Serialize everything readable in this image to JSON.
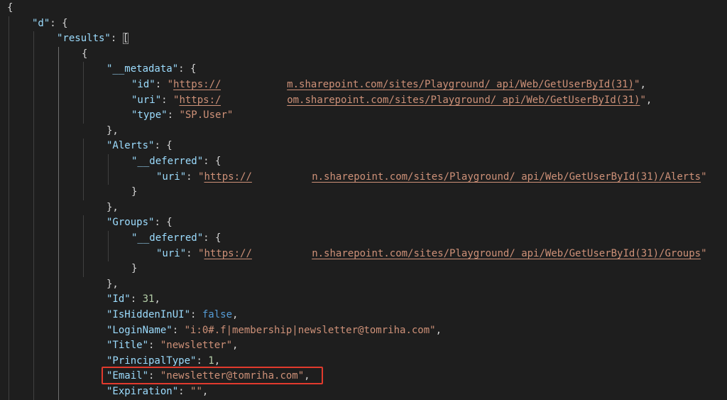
{
  "lines": [
    [
      {
        "t": "{",
        "c": "punc"
      }
    ],
    [
      {
        "t": "\"d\"",
        "c": "key"
      },
      {
        "t": ": {",
        "c": "punc"
      }
    ],
    [
      {
        "t": "\"results\"",
        "c": "key"
      },
      {
        "t": ": ",
        "c": "punc"
      },
      {
        "t": "[",
        "c": "punc bracket-match"
      }
    ],
    [
      {
        "t": "{",
        "c": "punc"
      }
    ],
    [
      {
        "t": "\"__metadata\"",
        "c": "key"
      },
      {
        "t": ": {",
        "c": "punc"
      }
    ],
    [
      {
        "t": "\"id\"",
        "c": "key"
      },
      {
        "t": ": ",
        "c": "punc"
      },
      {
        "t": "\"",
        "c": "str"
      },
      {
        "t": "https://",
        "c": "link"
      },
      {
        "t": "           ",
        "c": "redact"
      },
      {
        "t": "m.sharepoint.com/sites/Playground/_api/Web/GetUserById(31)",
        "c": "link"
      },
      {
        "t": "\"",
        "c": "str"
      },
      {
        "t": ",",
        "c": "punc"
      }
    ],
    [
      {
        "t": "\"uri\"",
        "c": "key"
      },
      {
        "t": ": ",
        "c": "punc"
      },
      {
        "t": "\"",
        "c": "str"
      },
      {
        "t": "https:/",
        "c": "link"
      },
      {
        "t": "           ",
        "c": "redact"
      },
      {
        "t": "om.sharepoint.com/sites/Playground/_api/Web/GetUserById(31)",
        "c": "link"
      },
      {
        "t": "\"",
        "c": "str"
      },
      {
        "t": ",",
        "c": "punc"
      }
    ],
    [
      {
        "t": "\"type\"",
        "c": "key"
      },
      {
        "t": ": ",
        "c": "punc"
      },
      {
        "t": "\"SP.User\"",
        "c": "str"
      }
    ],
    [
      {
        "t": "},",
        "c": "punc"
      }
    ],
    [
      {
        "t": "\"Alerts\"",
        "c": "key"
      },
      {
        "t": ": {",
        "c": "punc"
      }
    ],
    [
      {
        "t": "\"__deferred\"",
        "c": "key"
      },
      {
        "t": ": {",
        "c": "punc"
      }
    ],
    [
      {
        "t": "\"uri\"",
        "c": "key"
      },
      {
        "t": ": ",
        "c": "punc"
      },
      {
        "t": "\"",
        "c": "str"
      },
      {
        "t": "https://",
        "c": "link"
      },
      {
        "t": "          ",
        "c": "redact"
      },
      {
        "t": "n.sharepoint.com/sites/Playground/_api/Web/GetUserById(31)/Alerts",
        "c": "link"
      },
      {
        "t": "\"",
        "c": "str"
      }
    ],
    [
      {
        "t": "}",
        "c": "punc"
      }
    ],
    [
      {
        "t": "},",
        "c": "punc"
      }
    ],
    [
      {
        "t": "\"Groups\"",
        "c": "key"
      },
      {
        "t": ": {",
        "c": "punc"
      }
    ],
    [
      {
        "t": "\"__deferred\"",
        "c": "key"
      },
      {
        "t": ": {",
        "c": "punc"
      }
    ],
    [
      {
        "t": "\"uri\"",
        "c": "key"
      },
      {
        "t": ": ",
        "c": "punc"
      },
      {
        "t": "\"",
        "c": "str"
      },
      {
        "t": "https://",
        "c": "link"
      },
      {
        "t": "          ",
        "c": "redact"
      },
      {
        "t": "n.sharepoint.com/sites/Playground/_api/Web/GetUserById(31)/Groups",
        "c": "link"
      },
      {
        "t": "\"",
        "c": "str"
      }
    ],
    [
      {
        "t": "}",
        "c": "punc"
      }
    ],
    [
      {
        "t": "},",
        "c": "punc"
      }
    ],
    [
      {
        "t": "\"Id\"",
        "c": "key"
      },
      {
        "t": ": ",
        "c": "punc"
      },
      {
        "t": "31",
        "c": "num"
      },
      {
        "t": ",",
        "c": "punc"
      }
    ],
    [
      {
        "t": "\"IsHiddenInUI\"",
        "c": "key"
      },
      {
        "t": ": ",
        "c": "punc"
      },
      {
        "t": "false",
        "c": "kw"
      },
      {
        "t": ",",
        "c": "punc"
      }
    ],
    [
      {
        "t": "\"LoginName\"",
        "c": "key"
      },
      {
        "t": ": ",
        "c": "punc"
      },
      {
        "t": "\"i:0#.f|membership|newsletter@tomriha.com\"",
        "c": "str"
      },
      {
        "t": ",",
        "c": "punc"
      }
    ],
    [
      {
        "t": "\"Title\"",
        "c": "key"
      },
      {
        "t": ": ",
        "c": "punc"
      },
      {
        "t": "\"newsletter\"",
        "c": "str"
      },
      {
        "t": ",",
        "c": "punc"
      }
    ],
    [
      {
        "t": "\"PrincipalType\"",
        "c": "key"
      },
      {
        "t": ": ",
        "c": "punc"
      },
      {
        "t": "1",
        "c": "num"
      },
      {
        "t": ",",
        "c": "punc"
      }
    ],
    [
      {
        "t": "\"Email\"",
        "c": "key"
      },
      {
        "t": ": ",
        "c": "punc"
      },
      {
        "t": "\"newsletter@tomriha.com\"",
        "c": "str"
      },
      {
        "t": ",",
        "c": "punc"
      }
    ],
    [
      {
        "t": "\"Expiration\"",
        "c": "key"
      },
      {
        "t": ": ",
        "c": "punc"
      },
      {
        "t": "\"\"",
        "c": "str"
      },
      {
        "t": ",",
        "c": "punc"
      }
    ]
  ],
  "colors": {
    "background": "#1e1e1e",
    "key": "#9cdcfe",
    "string": "#ce9178",
    "number": "#b5cea8",
    "keyword": "#569cd6",
    "highlight_box": "#e23a2d"
  }
}
